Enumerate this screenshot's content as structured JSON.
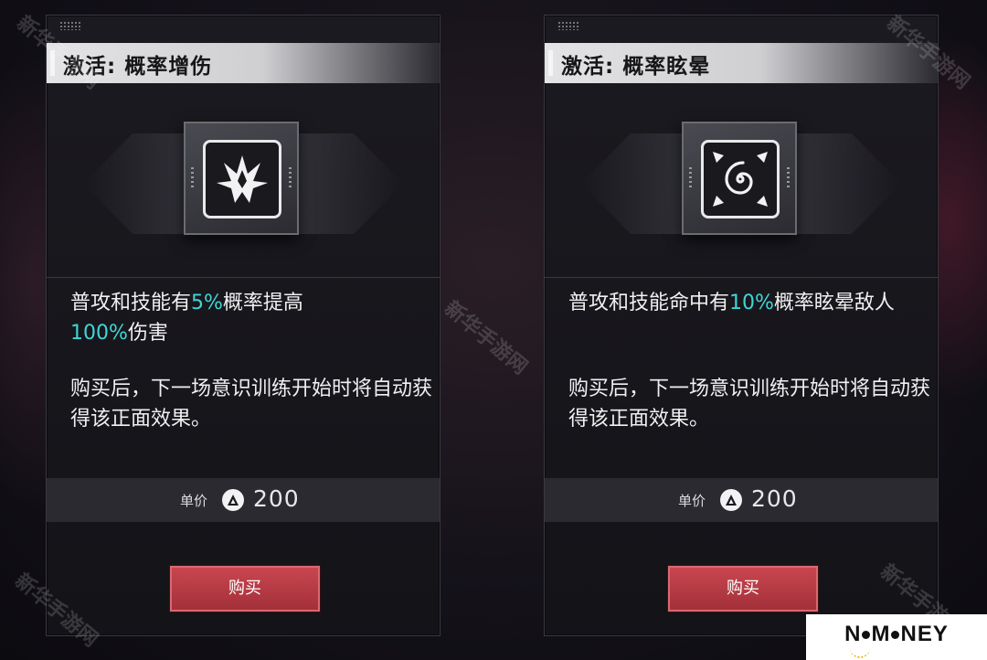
{
  "cards": [
    {
      "title": "激活: 概率增伤",
      "icon": "burst-crown-icon",
      "desc_pre": "普攻和技能有",
      "desc_hl1": "5%",
      "desc_mid": "概率提高",
      "desc_hl2": "100%",
      "desc_post": "伤害",
      "note": "购买后，下一场意识训练开始时将自动获得该正面效果。",
      "price_label": "单价",
      "price_value": "200",
      "buy_label": "购买"
    },
    {
      "title": "激活: 概率眩晕",
      "icon": "spiral-stun-icon",
      "desc_pre": "普攻和技能命中有",
      "desc_hl1": "10%",
      "desc_mid": "概率眩晕敌人",
      "note": "购买后，下一场意识训练开始时将自动获得该正面效果。",
      "price_label": "单价",
      "price_value": "200",
      "buy_label": "购买"
    }
  ],
  "watermark": "新华手游网",
  "logo": {
    "left": "N",
    "middle": "M",
    "right": "NEY"
  },
  "colors": {
    "highlight": "#3fd6d6",
    "buy_button": "#b83a44"
  }
}
